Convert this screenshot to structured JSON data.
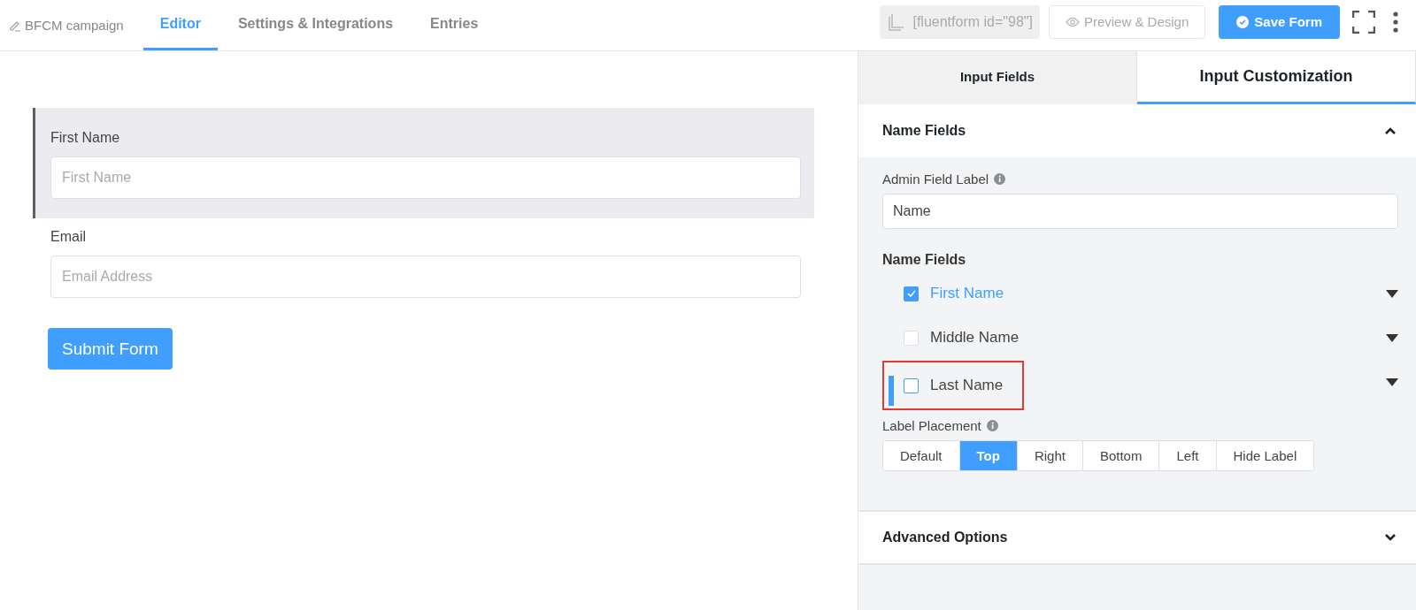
{
  "header": {
    "form_name": "BFCM campaign",
    "tabs": [
      {
        "label": "Editor",
        "selected": true
      },
      {
        "label": "Settings & Integrations",
        "selected": false
      },
      {
        "label": "Entries",
        "selected": false
      }
    ],
    "shortcode": "[fluentform id=\"98\"]",
    "preview_button": "Preview & Design",
    "save_button": "Save Form"
  },
  "form": {
    "fields": [
      {
        "label": "First Name",
        "placeholder": "First Name",
        "selected": true
      },
      {
        "label": "Email",
        "placeholder": "Email Address",
        "selected": false
      }
    ],
    "submit_button": "Submit Form"
  },
  "panel": {
    "tabs": [
      {
        "label": "Input Fields",
        "selected": false
      },
      {
        "label": "Input Customization",
        "selected": true
      }
    ],
    "name_section": {
      "title": "Name Fields",
      "expanded": true,
      "admin_label": "Admin Field Label",
      "admin_value": "Name",
      "subfields_title": "Name Fields",
      "subfields": [
        {
          "label": "First Name",
          "checked": true,
          "highlighted": false
        },
        {
          "label": "Middle Name",
          "checked": false,
          "highlighted": false
        },
        {
          "label": "Last Name",
          "checked": false,
          "highlighted": true
        }
      ],
      "placement_label": "Label Placement",
      "placements": [
        {
          "label": "Default",
          "selected": false
        },
        {
          "label": "Top",
          "selected": true
        },
        {
          "label": "Right",
          "selected": false
        },
        {
          "label": "Bottom",
          "selected": false
        },
        {
          "label": "Left",
          "selected": false
        },
        {
          "label": "Hide Label",
          "selected": false
        }
      ]
    },
    "advanced_section": {
      "title": "Advanced Options",
      "expanded": false
    }
  }
}
